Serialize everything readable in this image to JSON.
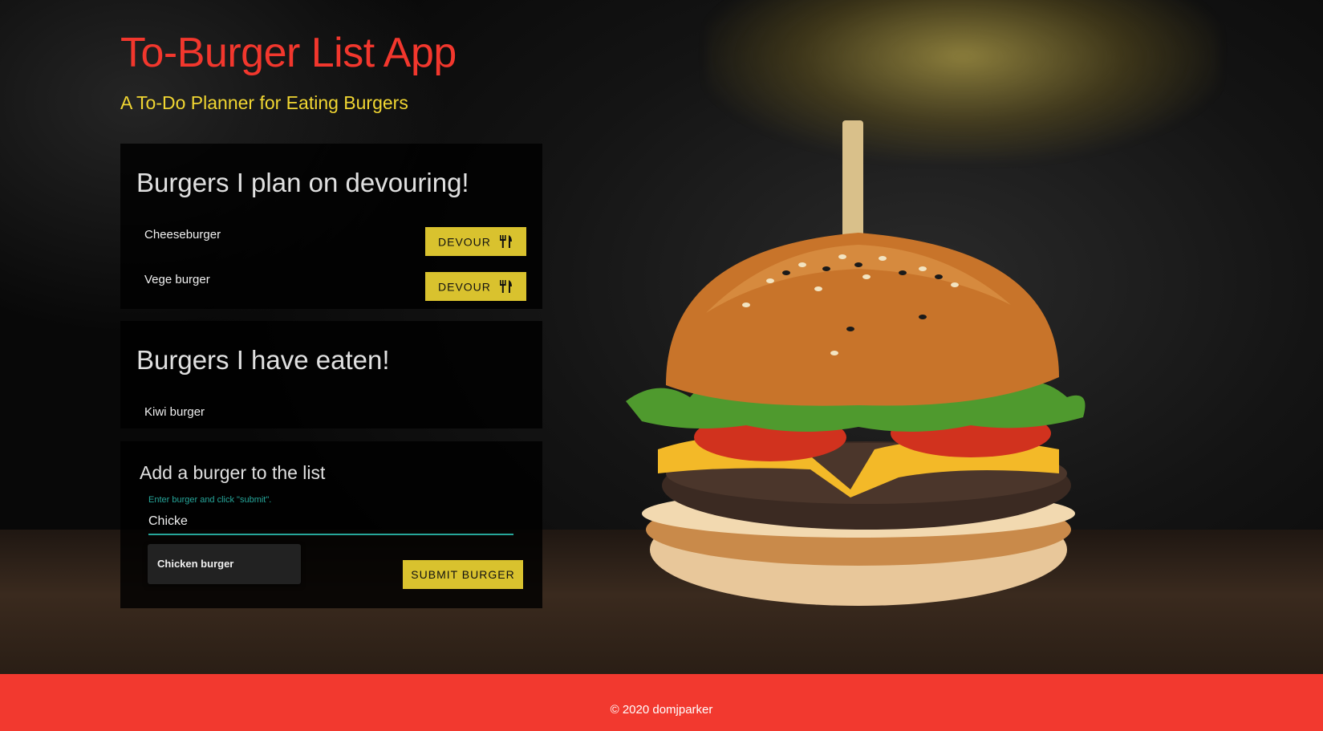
{
  "header": {
    "title": "To-Burger List App",
    "subtitle": "A To-Do Planner for Eating Burgers"
  },
  "devour_panel": {
    "heading": "Burgers I plan on devouring!",
    "button_label": "DEVOUR",
    "button_icon": "fork-knife-icon",
    "items": [
      {
        "name": "Cheeseburger"
      },
      {
        "name": "Vege burger"
      }
    ]
  },
  "eaten_panel": {
    "heading": "Burgers I have eaten!",
    "items": [
      {
        "name": "Kiwi burger"
      }
    ]
  },
  "add_panel": {
    "heading": "Add a burger to the list",
    "helper": "Enter burger and click \"submit\".",
    "input_value": "Chicke",
    "autocomplete": [
      "Chicken burger"
    ],
    "submit_label": "SUBMIT BURGER"
  },
  "footer": {
    "text": "© 2020 domjparker"
  },
  "colors": {
    "title": "#f2372d",
    "subtitle": "#f1d632",
    "button": "#d9c22e",
    "accent": "#26a69a",
    "footer": "#f2392f"
  }
}
